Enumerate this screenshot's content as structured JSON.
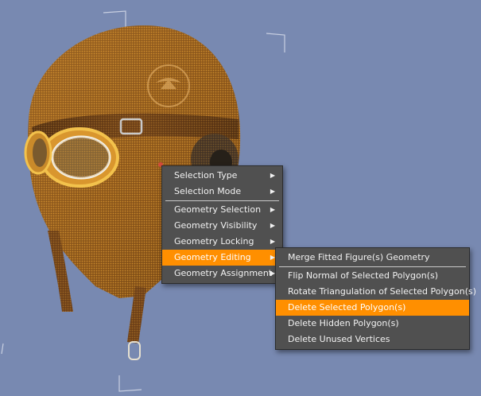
{
  "scene": {
    "background_color": "#7889b1",
    "object": "aviator-helmet-with-goggles",
    "selection_overlay_color": "#ff8f00"
  },
  "context_menu": {
    "items": [
      {
        "label": "Selection Type",
        "submenu": true
      },
      {
        "label": "Selection Mode",
        "submenu": true
      },
      {
        "label": "Geometry Selection",
        "submenu": true
      },
      {
        "label": "Geometry Visibility",
        "submenu": true
      },
      {
        "label": "Geometry Locking",
        "submenu": true
      },
      {
        "label": "Geometry Editing",
        "submenu": true,
        "highlighted": true
      },
      {
        "label": "Geometry Assignment",
        "submenu": true
      }
    ]
  },
  "submenu": {
    "items": [
      {
        "label": "Merge Fitted Figure(s) Geometry"
      },
      {
        "label": "Flip Normal of Selected Polygon(s)"
      },
      {
        "label": "Rotate Triangulation of Selected Polygon(s)"
      },
      {
        "label": "Delete Selected Polygon(s)",
        "highlighted": true
      },
      {
        "label": "Delete Hidden Polygon(s)"
      },
      {
        "label": "Delete Unused Vertices"
      }
    ]
  },
  "arrow_glyph": "▶",
  "highlight_color": "#ff8f00"
}
